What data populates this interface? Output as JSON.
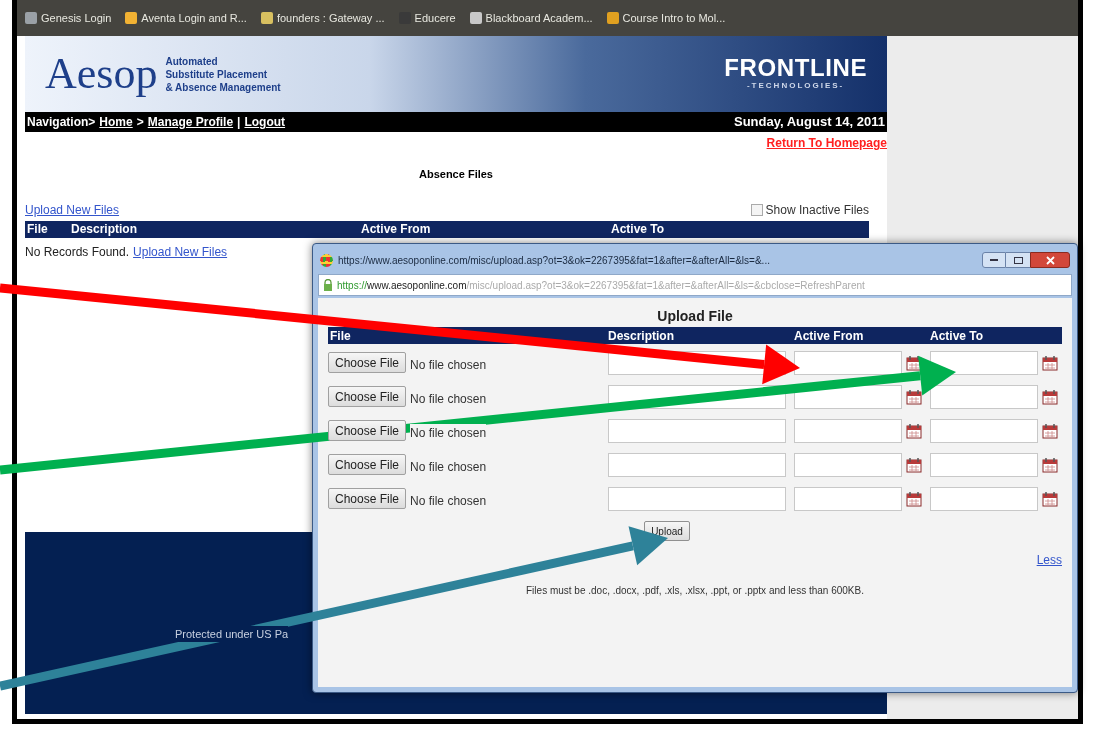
{
  "bookmarks": [
    {
      "label": "Genesis Login",
      "color": "#9aa0a6"
    },
    {
      "label": "Aventa Login and R...",
      "color": "#f2b233"
    },
    {
      "label": "founders : Gateway ...",
      "color": "#d8c060"
    },
    {
      "label": "Educere",
      "color": "#3a3a3a"
    },
    {
      "label": "Blackboard Academ...",
      "color": "#c8c8c8"
    },
    {
      "label": "Course Intro to Mol...",
      "color": "#e0a020"
    }
  ],
  "header": {
    "logo": "Aesop",
    "tagline": [
      "Automated",
      "Substitute Placement",
      "& Absence Management"
    ],
    "brand": "FRONTLINE",
    "brand_sub": "-TECHNOLOGIES-"
  },
  "nav": {
    "items": [
      {
        "kind": "text",
        "text": "Navigation>"
      },
      {
        "kind": "link",
        "text": "Home"
      },
      {
        "kind": "text",
        "text": ">"
      },
      {
        "kind": "link",
        "text": "Manage Profile"
      },
      {
        "kind": "text",
        "text": "|"
      },
      {
        "kind": "link",
        "text": "Logout"
      }
    ],
    "date": "Sunday, August 14, 2011"
  },
  "return_link": "Return To Homepage",
  "section_title": "Absence Files",
  "upload_link": "Upload New Files",
  "show_inactive": {
    "label": "Show Inactive Files",
    "checked": false
  },
  "table": {
    "columns": [
      "File",
      "Description",
      "Active From",
      "Active To"
    ],
    "empty_text": "No Records Found.",
    "empty_link": "Upload New Files"
  },
  "footer_text": "Protected under US Pa",
  "popup": {
    "title": "https://www.aesoponline.com/misc/upload.asp?ot=3&ok=2267395&fat=1&after=&afterAll=&ls=&...",
    "address": {
      "scheme": "https://",
      "host": "www.aesoponline.com",
      "path": "/misc/upload.asp?ot=3&ok=2267395&fat=1&after=&afterAll=&ls=&cbclose=RefreshParent"
    },
    "heading": "Upload File",
    "columns": [
      "File",
      "Description",
      "Active From",
      "Active To"
    ],
    "rows": [
      {
        "button": "Choose File",
        "status": "No file chosen"
      },
      {
        "button": "Choose File",
        "status": "No file chosen"
      },
      {
        "button": "Choose File",
        "status": "No file chosen"
      },
      {
        "button": "Choose File",
        "status": "No file chosen"
      },
      {
        "button": "Choose File",
        "status": "No file chosen"
      }
    ],
    "upload_button": "Upload",
    "less_link": "Less",
    "note": "Files must be .doc, .docx, .pdf, .xls, .xlsx, .ppt, or .pptx and less than 600KB."
  },
  "annotations": [
    {
      "color": "#ff0000"
    },
    {
      "color": "#00b04f"
    },
    {
      "color": "#2e8299"
    }
  ]
}
